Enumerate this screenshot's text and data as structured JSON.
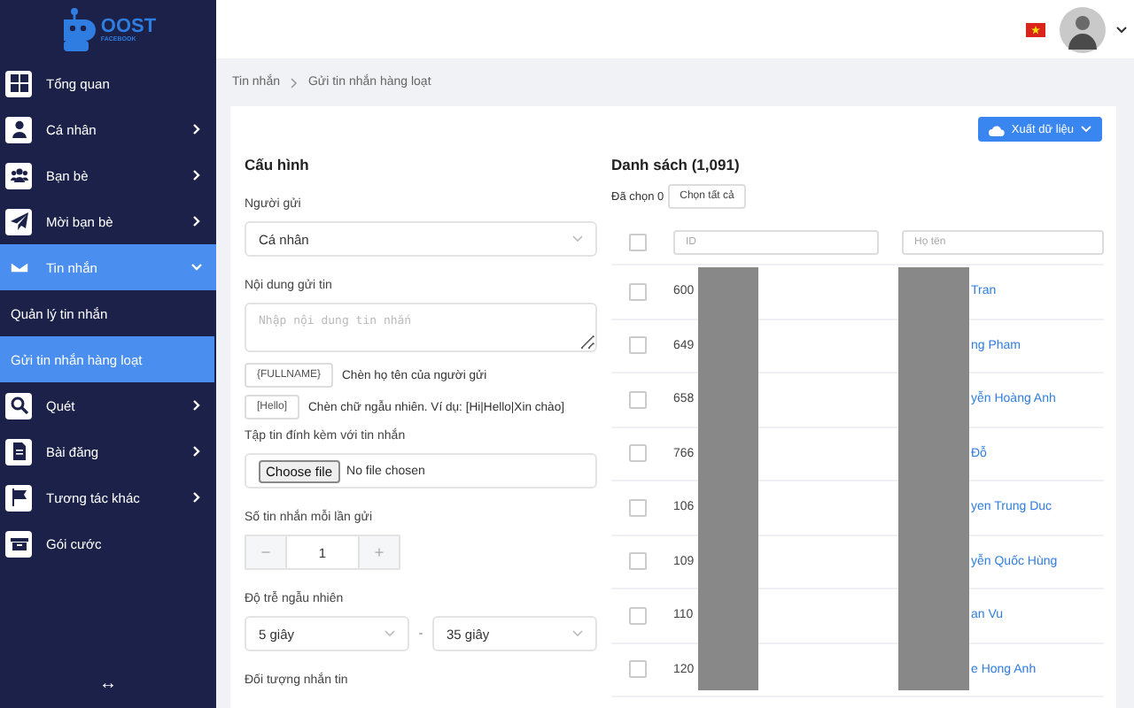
{
  "logo": {
    "name": "OOST",
    "tagline": "FACEBOOK"
  },
  "sidebar": {
    "items": [
      {
        "label": "Tổng quan",
        "has_submenu": false,
        "expanded": false
      },
      {
        "label": "Cá nhân",
        "has_submenu": true,
        "expanded": false
      },
      {
        "label": "Bạn bè",
        "has_submenu": true,
        "expanded": false
      },
      {
        "label": "Mời bạn bè",
        "has_submenu": true,
        "expanded": false
      },
      {
        "label": "Tin nhắn",
        "has_submenu": true,
        "expanded": true,
        "children": [
          {
            "label": "Quản lý tin nhắn",
            "selected": false
          },
          {
            "label": "Gửi tin nhắn hàng loạt",
            "selected": true
          }
        ]
      },
      {
        "label": "Quét",
        "has_submenu": true,
        "expanded": false
      },
      {
        "label": "Bài đăng",
        "has_submenu": true,
        "expanded": false
      },
      {
        "label": "Tương tác khác",
        "has_submenu": true,
        "expanded": false
      },
      {
        "label": "Gói cước",
        "has_submenu": false,
        "expanded": false
      }
    ],
    "collapse": "↔"
  },
  "breadcrumb": [
    "Tin nhắn",
    "Gửi tin nhắn hàng loạt"
  ],
  "export_button": "Xuất dữ liệu",
  "config": {
    "title": "Cấu hình",
    "sender": {
      "label": "Người gửi",
      "value": "Cá nhân"
    },
    "content": {
      "label": "Nội dung gửi tin",
      "placeholder": "Nhập nội dung tin nhắn"
    },
    "variables": [
      {
        "tag": "{FULLNAME}",
        "description": "Chèn họ tên của người gửi"
      },
      {
        "tag": "[Hello]",
        "description": "Chèn chữ ngẫu nhiên. Ví dụ: [Hi|Hello|Xin chào]"
      }
    ],
    "attachment": {
      "label": "Tập tin đính kèm với tin nhắn",
      "button": "Choose file",
      "status": "No file chosen"
    },
    "per_send": {
      "label": "Số tin nhắn mỗi lần gửi",
      "minus": "−",
      "value": "1",
      "plus": "+"
    },
    "delay": {
      "label": "Độ trễ ngẫu nhiên",
      "from": "5 giây",
      "separator": "-",
      "to": "35 giây"
    },
    "target": {
      "label": "Đối tượng nhắn tin"
    }
  },
  "list": {
    "title": "Danh sách (1,091)",
    "selected_count": "Đã chọn 0",
    "select_all": "Chọn tất cả",
    "header_checked": false,
    "filters": [
      {
        "placeholder": "ID"
      },
      {
        "placeholder": "Họ tên"
      }
    ],
    "rows": [
      {
        "id": "600",
        "name": "Tran",
        "checked": false
      },
      {
        "id": "649",
        "name": "ng Pham",
        "checked": false
      },
      {
        "id": "658",
        "name": "yễn Hoàng Anh",
        "checked": false
      },
      {
        "id": "766",
        "name": "Đỗ",
        "checked": false
      },
      {
        "id": "106",
        "name": "yen Trung Duc",
        "checked": false
      },
      {
        "id": "109",
        "name": "yễn Quốc Hùng",
        "checked": false
      },
      {
        "id": "110",
        "name": "an Vu",
        "checked": false
      },
      {
        "id": "120",
        "name": "e Hong Anh",
        "checked": false
      }
    ]
  }
}
